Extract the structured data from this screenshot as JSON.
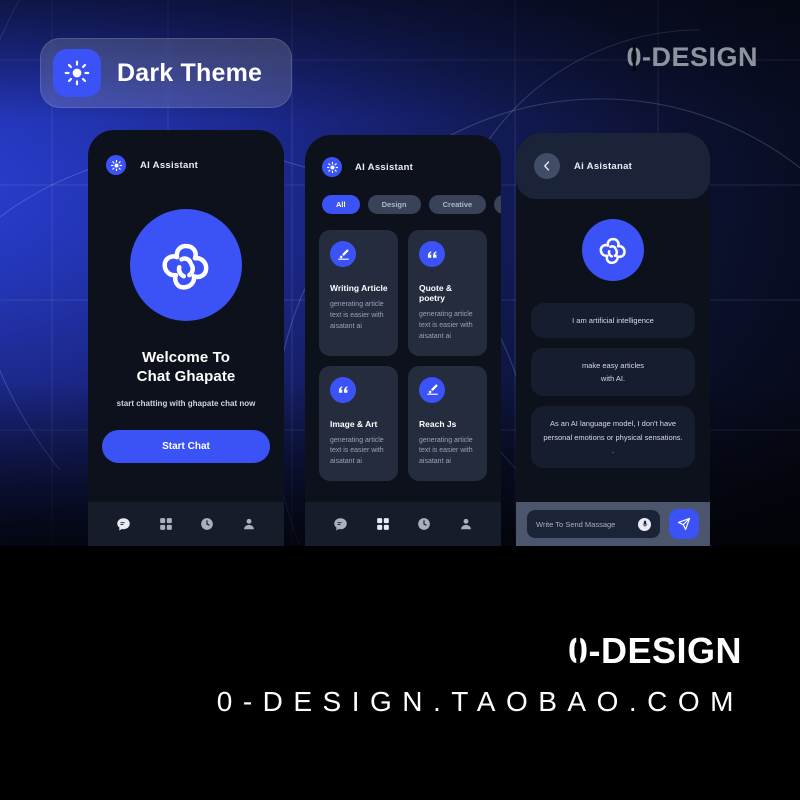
{
  "hero": {
    "theme_badge": {
      "label": "Dark Theme",
      "icon": "sun-icon"
    },
    "logo": {
      "zero": "0",
      "rest": "-DESIGN"
    }
  },
  "phone1": {
    "header": {
      "title": "AI Assistant",
      "icon": "sun-dot-icon"
    },
    "brand_icon": "openai-flower-icon",
    "welcome_line1": "Welcome To",
    "welcome_line2": "Chat Ghapate",
    "subtitle": "start chatting with ghapate chat now",
    "cta_label": "Start Chat",
    "tabs": [
      {
        "name": "chat",
        "icon": "chat-bubble-icon",
        "active": true
      },
      {
        "name": "apps",
        "icon": "grid-icon",
        "active": false
      },
      {
        "name": "history",
        "icon": "clock-icon",
        "active": false
      },
      {
        "name": "profile",
        "icon": "person-icon",
        "active": false
      }
    ]
  },
  "phone2": {
    "header": {
      "title": "AI Assistant",
      "icon": "sun-dot-icon"
    },
    "chips": [
      {
        "label": "All",
        "active": true
      },
      {
        "label": "Design",
        "active": false
      },
      {
        "label": "Creative",
        "active": false
      },
      {
        "label": "",
        "active": false
      }
    ],
    "cards": [
      {
        "title": "Writing Article",
        "desc": "generating article text is easier with aisatant ai",
        "icon": "pen-icon"
      },
      {
        "title": "Quote & poetry",
        "desc": "generating article text is easier with aisatant ai",
        "icon": "quote-icon"
      },
      {
        "title": "Image & Art",
        "desc": "generating article text is easier with aisatant ai",
        "icon": "quote-icon"
      },
      {
        "title": "Reach Js",
        "desc": "generating article text is easier with aisatant ai",
        "icon": "pen-icon"
      }
    ],
    "tabs": [
      {
        "name": "chat",
        "icon": "chat-bubble-icon",
        "active": false
      },
      {
        "name": "apps",
        "icon": "grid-icon",
        "active": true
      },
      {
        "name": "history",
        "icon": "clock-icon",
        "active": false
      },
      {
        "name": "profile",
        "icon": "person-icon",
        "active": false
      }
    ]
  },
  "phone3": {
    "header": {
      "title": "Ai Asistanat",
      "back_icon": "chevron-left-icon"
    },
    "avatar_icon": "openai-flower-icon",
    "messages": [
      "I am artificial intelligence",
      "make easy articles\nwith AI.",
      "As an AI language model, I don't have personal emotions or physical sensations. ."
    ],
    "composer": {
      "placeholder": "Write To Send Massage",
      "mic_icon": "mic-icon",
      "send_icon": "send-icon"
    }
  },
  "footer": {
    "logo": {
      "zero": "0",
      "rest": "-DESIGN"
    },
    "url": "0-DESIGN.TAOBAO.COM"
  },
  "colors": {
    "accent": "#3b52f6",
    "hero_blue": "#2335b4",
    "phone_bg": "#0d111c",
    "card_bg": "#242c3e",
    "bubble_bg": "#161d2e",
    "tabbar_bg": "#171c2b",
    "composer_bg": "#4b566d"
  }
}
